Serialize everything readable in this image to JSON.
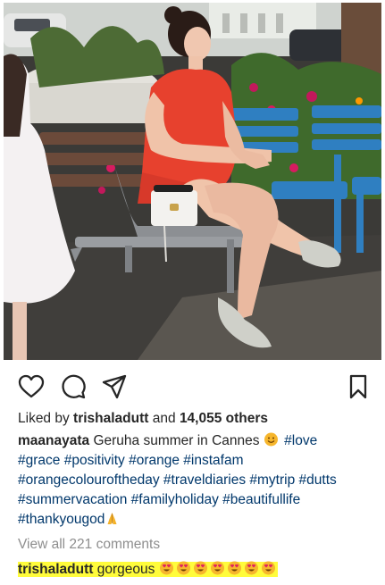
{
  "post": {
    "image_alt": "Woman in orange dress sitting on a bench in Cannes",
    "actions": {
      "like_icon": "heart-icon",
      "comment_icon": "comment-icon",
      "share_icon": "paper-plane-icon",
      "save_icon": "bookmark-icon"
    },
    "likes": {
      "prefix": "Liked by ",
      "user": "trishaladutt",
      "middle": " and ",
      "count": "14,055 others"
    },
    "caption": {
      "username": "maanayata",
      "text": "Geruha summer in Cannes",
      "hashtags": [
        "#love",
        "#grace",
        "#positivity",
        "#orange",
        "#instafam",
        "#orangecolouroftheday",
        "#traveldiaries",
        "#mytrip",
        "#dutts",
        "#summervacation",
        "#familyholiday",
        "#beautifullife",
        "#thankyougod"
      ]
    },
    "view_all_comments": "View all 221 comments",
    "comment": {
      "username": "trishaladutt",
      "text": "gorgeous",
      "emoji_count": 7
    },
    "colors": {
      "hashtag": "#00376b",
      "muted": "#8e8e8e",
      "highlight": "#fffc3b"
    }
  }
}
